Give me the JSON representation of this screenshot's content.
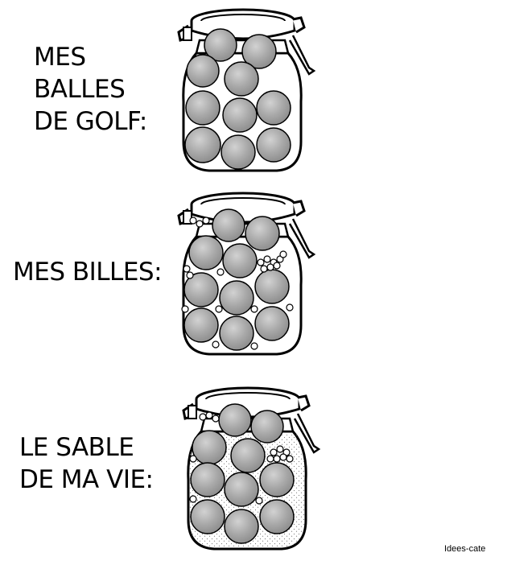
{
  "captions": {
    "golf": [
      "MES",
      "BALLES",
      "DE GOLF:"
    ],
    "billes": [
      "MES BILLES:"
    ],
    "sable": [
      "LE SABLE",
      "DE MA VIE:"
    ]
  },
  "credit": "Idees-cate",
  "colors": {
    "ink": "#000000",
    "ball_fill": "#9c9c9c",
    "ball_highlight": "#d2d2d2",
    "sand_dots": "#7a7a7a",
    "background": "#ffffff"
  },
  "jars": [
    {
      "name": "jar-golf",
      "golf_balls": 10,
      "marbles": false,
      "sand": false
    },
    {
      "name": "jar-marbles",
      "golf_balls": 10,
      "marbles": true,
      "sand": false
    },
    {
      "name": "jar-sand",
      "golf_balls": 10,
      "marbles": true,
      "sand": true
    }
  ]
}
